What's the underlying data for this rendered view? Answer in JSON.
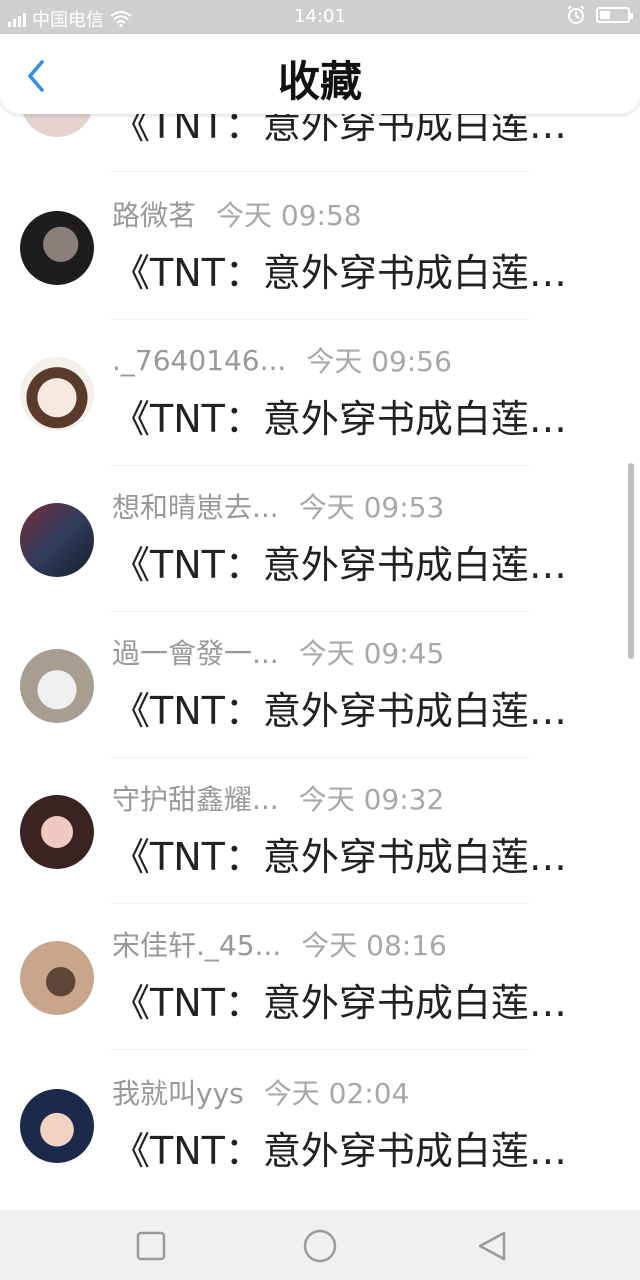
{
  "status_bar": {
    "carrier": "中国电信",
    "time": "14:01"
  },
  "header": {
    "title": "收藏"
  },
  "items": [
    {
      "name": "",
      "time": "",
      "message": "《TNT：意外穿书成白莲女…",
      "avatar_color": "#e6d3cf"
    },
    {
      "name": "路微茗",
      "time": "今天 09:58",
      "message": "《TNT：意外穿书成白莲女…",
      "avatar_color": "#2b2b2b"
    },
    {
      "name": "._7640146...",
      "time": "今天 09:56",
      "message": "《TNT：意外穿书成白莲女…",
      "avatar_color": "#f3e7de"
    },
    {
      "name": "想和晴崽去...",
      "time": "今天 09:53",
      "message": "《TNT：意外穿书成白莲女…",
      "avatar_color": "#324766"
    },
    {
      "name": "過一會發一...",
      "time": "今天 09:45",
      "message": "《TNT：意外穿书成白莲女…",
      "avatar_color": "#c9c2b5"
    },
    {
      "name": "守护甜鑫耀...",
      "time": "今天 09:32",
      "message": "《TNT：意外穿书成白莲女…",
      "avatar_color": "#d7a39b"
    },
    {
      "name": "宋佳轩._45...",
      "time": "今天 08:16",
      "message": "《TNT：意外穿书成白莲女…",
      "avatar_color": "#bf9f89"
    },
    {
      "name": "我就叫yys",
      "time": "今天 02:04",
      "message": "《TNT：意外穿书成白莲女…",
      "avatar_color": "#1f2f52"
    }
  ]
}
